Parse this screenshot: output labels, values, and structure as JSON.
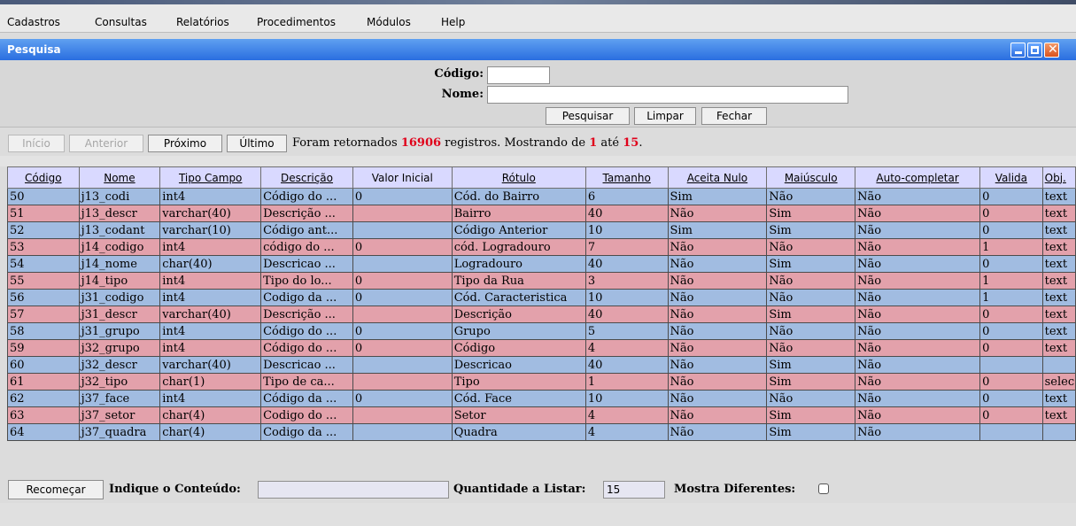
{
  "menu": {
    "items": [
      "Cadastros",
      "Consultas",
      "Relatórios",
      "Procedimentos",
      "Módulos",
      "Help"
    ]
  },
  "window": {
    "title": "Pesquisa"
  },
  "form": {
    "codigo_label": "Código:",
    "codigo_value": "",
    "nome_label": "Nome:",
    "nome_value": "",
    "pesquisar": "Pesquisar",
    "limpar": "Limpar",
    "fechar": "Fechar"
  },
  "nav": {
    "inicio": "Início",
    "anterior": "Anterior",
    "proximo": "Próximo",
    "ultimo": "Último",
    "status_prefix": "Foram retornados ",
    "total": "16906",
    "status_mid": " registros. Mostrando de ",
    "from": "1",
    "status_ate": " até ",
    "to": "15",
    "status_end": "."
  },
  "table": {
    "columns": [
      "Código",
      "Nome",
      "Tipo Campo",
      "Descrição",
      "Valor Inicial",
      "Rótulo",
      "Tamanho",
      "Aceita Nulo",
      "Maiúsculo",
      "Auto-completar",
      "Valida",
      "Obj."
    ],
    "rows": [
      [
        "50",
        "j13_codi",
        "int4",
        "Código do ...",
        "0",
        "Cód. do Bairro",
        "6",
        "Sim",
        "Não",
        "Não",
        "0",
        "text"
      ],
      [
        "51",
        "j13_descr",
        "varchar(40)",
        "Descrição ...",
        "",
        "Bairro",
        "40",
        "Não",
        "Sim",
        "Não",
        "0",
        "text"
      ],
      [
        "52",
        "j13_codant",
        "varchar(10)",
        "Código ant...",
        "",
        "Código Anterior",
        "10",
        "Sim",
        "Sim",
        "Não",
        "0",
        "text"
      ],
      [
        "53",
        "j14_codigo",
        "int4",
        "código do ...",
        "0",
        "cód. Logradouro",
        "7",
        "Não",
        "Não",
        "Não",
        "1",
        "text"
      ],
      [
        "54",
        "j14_nome",
        "char(40)",
        "Descricao ...",
        "",
        "Logradouro",
        "40",
        "Não",
        "Sim",
        "Não",
        "0",
        "text"
      ],
      [
        "55",
        "j14_tipo",
        "int4",
        "Tipo do lo...",
        "0",
        "Tipo da Rua",
        "3",
        "Não",
        "Não",
        "Não",
        "1",
        "text"
      ],
      [
        "56",
        "j31_codigo",
        "int4",
        "Codigo da ...",
        "0",
        "Cód. Caracteristica",
        "10",
        "Não",
        "Não",
        "Não",
        "1",
        "text"
      ],
      [
        "57",
        "j31_descr",
        "varchar(40)",
        "Descrição ...",
        "",
        "Descrição",
        "40",
        "Não",
        "Sim",
        "Não",
        "0",
        "text"
      ],
      [
        "58",
        "j31_grupo",
        "int4",
        "Código do ...",
        "0",
        "Grupo",
        "5",
        "Não",
        "Não",
        "Não",
        "0",
        "text"
      ],
      [
        "59",
        "j32_grupo",
        "int4",
        "Código do ...",
        "0",
        "Código",
        "4",
        "Não",
        "Não",
        "Não",
        "0",
        "text"
      ],
      [
        "60",
        "j32_descr",
        "varchar(40)",
        "Descricao ...",
        "",
        "Descricao",
        "40",
        "Não",
        "Sim",
        "Não",
        "",
        ""
      ],
      [
        "61",
        "j32_tipo",
        "char(1)",
        "Tipo de ca...",
        "",
        "Tipo",
        "1",
        "Não",
        "Sim",
        "Não",
        "0",
        "selec"
      ],
      [
        "62",
        "j37_face",
        "int4",
        "Código da ...",
        "0",
        "Cód. Face",
        "10",
        "Não",
        "Não",
        "Não",
        "0",
        "text"
      ],
      [
        "63",
        "j37_setor",
        "char(4)",
        "Codigo do ...",
        "",
        "Setor",
        "4",
        "Não",
        "Sim",
        "Não",
        "0",
        "text"
      ],
      [
        "64",
        "j37_quadra",
        "char(4)",
        "Codigo da ...",
        "",
        "Quadra",
        "4",
        "Não",
        "Sim",
        "Não",
        "",
        ""
      ]
    ]
  },
  "bottom": {
    "recomecar": "Recomeçar",
    "indique_label": "Indique o Conteúdo:",
    "indique_value": "",
    "quantidade_label": "Quantidade a Listar:",
    "quantidade_value": "15",
    "mostra_label": "Mostra Diferentes:"
  },
  "colors": {
    "row_blue": "#a1bce1",
    "row_pink": "#e3a1ab",
    "header_bg": "#d9d9ff",
    "title_bar": "#2a6ee0",
    "status_red": "#e0001a"
  }
}
